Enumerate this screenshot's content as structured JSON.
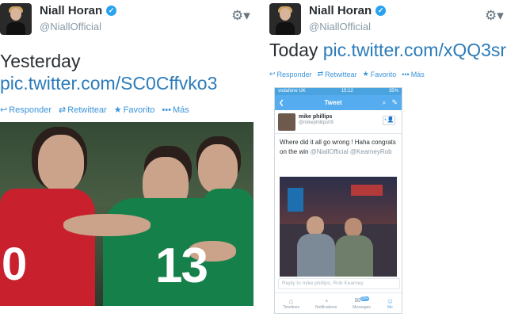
{
  "left": {
    "name": "Niall Horan",
    "handle": "@NiallOfficial",
    "text": "Yesterday",
    "link": "pic.twitter.com/SC0Cffvko3",
    "actions": [
      "Responder",
      "Retwittear",
      "Favorito",
      "Más"
    ],
    "jersey_number_green": "13",
    "jersey_number_red": "0"
  },
  "right": {
    "name": "Niall Horan",
    "handle": "@NiallOfficial",
    "text": "Today",
    "link": "pic.twitter.com/xQQ3sr",
    "actions": [
      "Responder",
      "Retwittear",
      "Favorito",
      "Más"
    ],
    "phone": {
      "carrier": "vodafone UK",
      "time": "15:12",
      "battery": "35%",
      "nav_title": "Tweet",
      "author_name": "mike phillips",
      "author_handle": "@mikephillips09",
      "text_plain": "Where did it all go wrong ! Haha congrats on the win",
      "mention1": "@NiallOfficial",
      "mention2": "@KearneyRob",
      "reply_placeholder": "Reply to mike phillips, Rob Kearney",
      "tabs": [
        "Timelines",
        "Notifications",
        "Messages",
        "Me"
      ],
      "messages_badge": "20+"
    }
  },
  "colors": {
    "link": "#2b7bb9",
    "accent": "#55acee",
    "verified": "#2aa3ef"
  }
}
